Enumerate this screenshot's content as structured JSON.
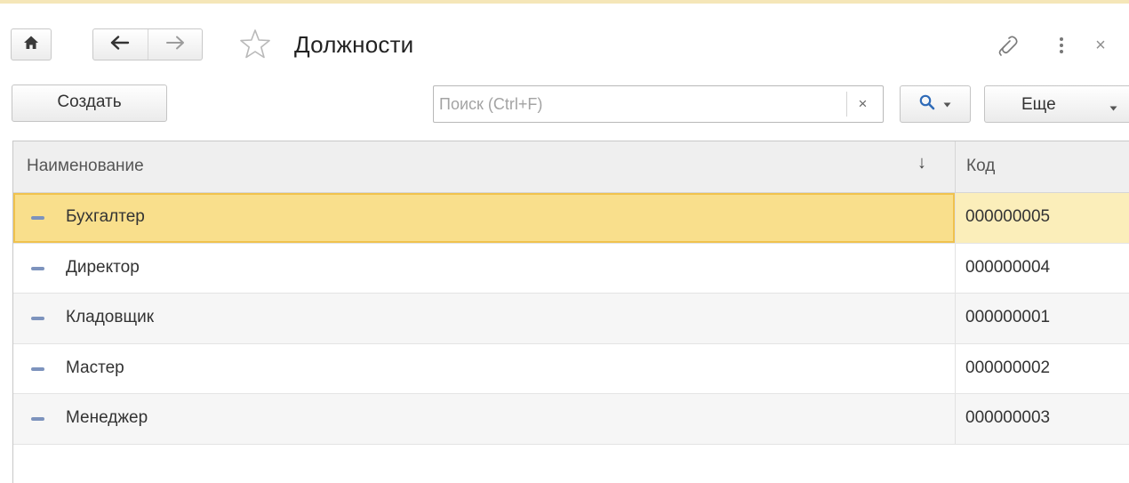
{
  "window": {
    "title": "Должности",
    "star_icon": "star-outline-icon",
    "link_icon": "link-icon",
    "more_icon": "vertical-dots-icon",
    "close_glyph": "×"
  },
  "toolbar": {
    "create_label": "Создать",
    "search_placeholder": "Поиск (Ctrl+F)",
    "search_value": "",
    "clear_glyph": "×",
    "more_label": "Еще"
  },
  "table": {
    "columns": {
      "name": "Наименование",
      "code": "Код",
      "sort_glyph": "↓"
    },
    "rows": [
      {
        "name": "Бухгалтер",
        "code": "000000005",
        "selected": true
      },
      {
        "name": "Директор",
        "code": "000000004",
        "selected": false
      },
      {
        "name": "Кладовщик",
        "code": "000000001",
        "selected": false
      },
      {
        "name": "Мастер",
        "code": "000000002",
        "selected": false
      },
      {
        "name": "Менеджер",
        "code": "000000003",
        "selected": false
      }
    ]
  },
  "colors": {
    "selection_fill": "#f9df8c",
    "selection_border": "#f0c24d",
    "row_marker": "#7d93bd",
    "search_accent": "#2f6bb8"
  }
}
